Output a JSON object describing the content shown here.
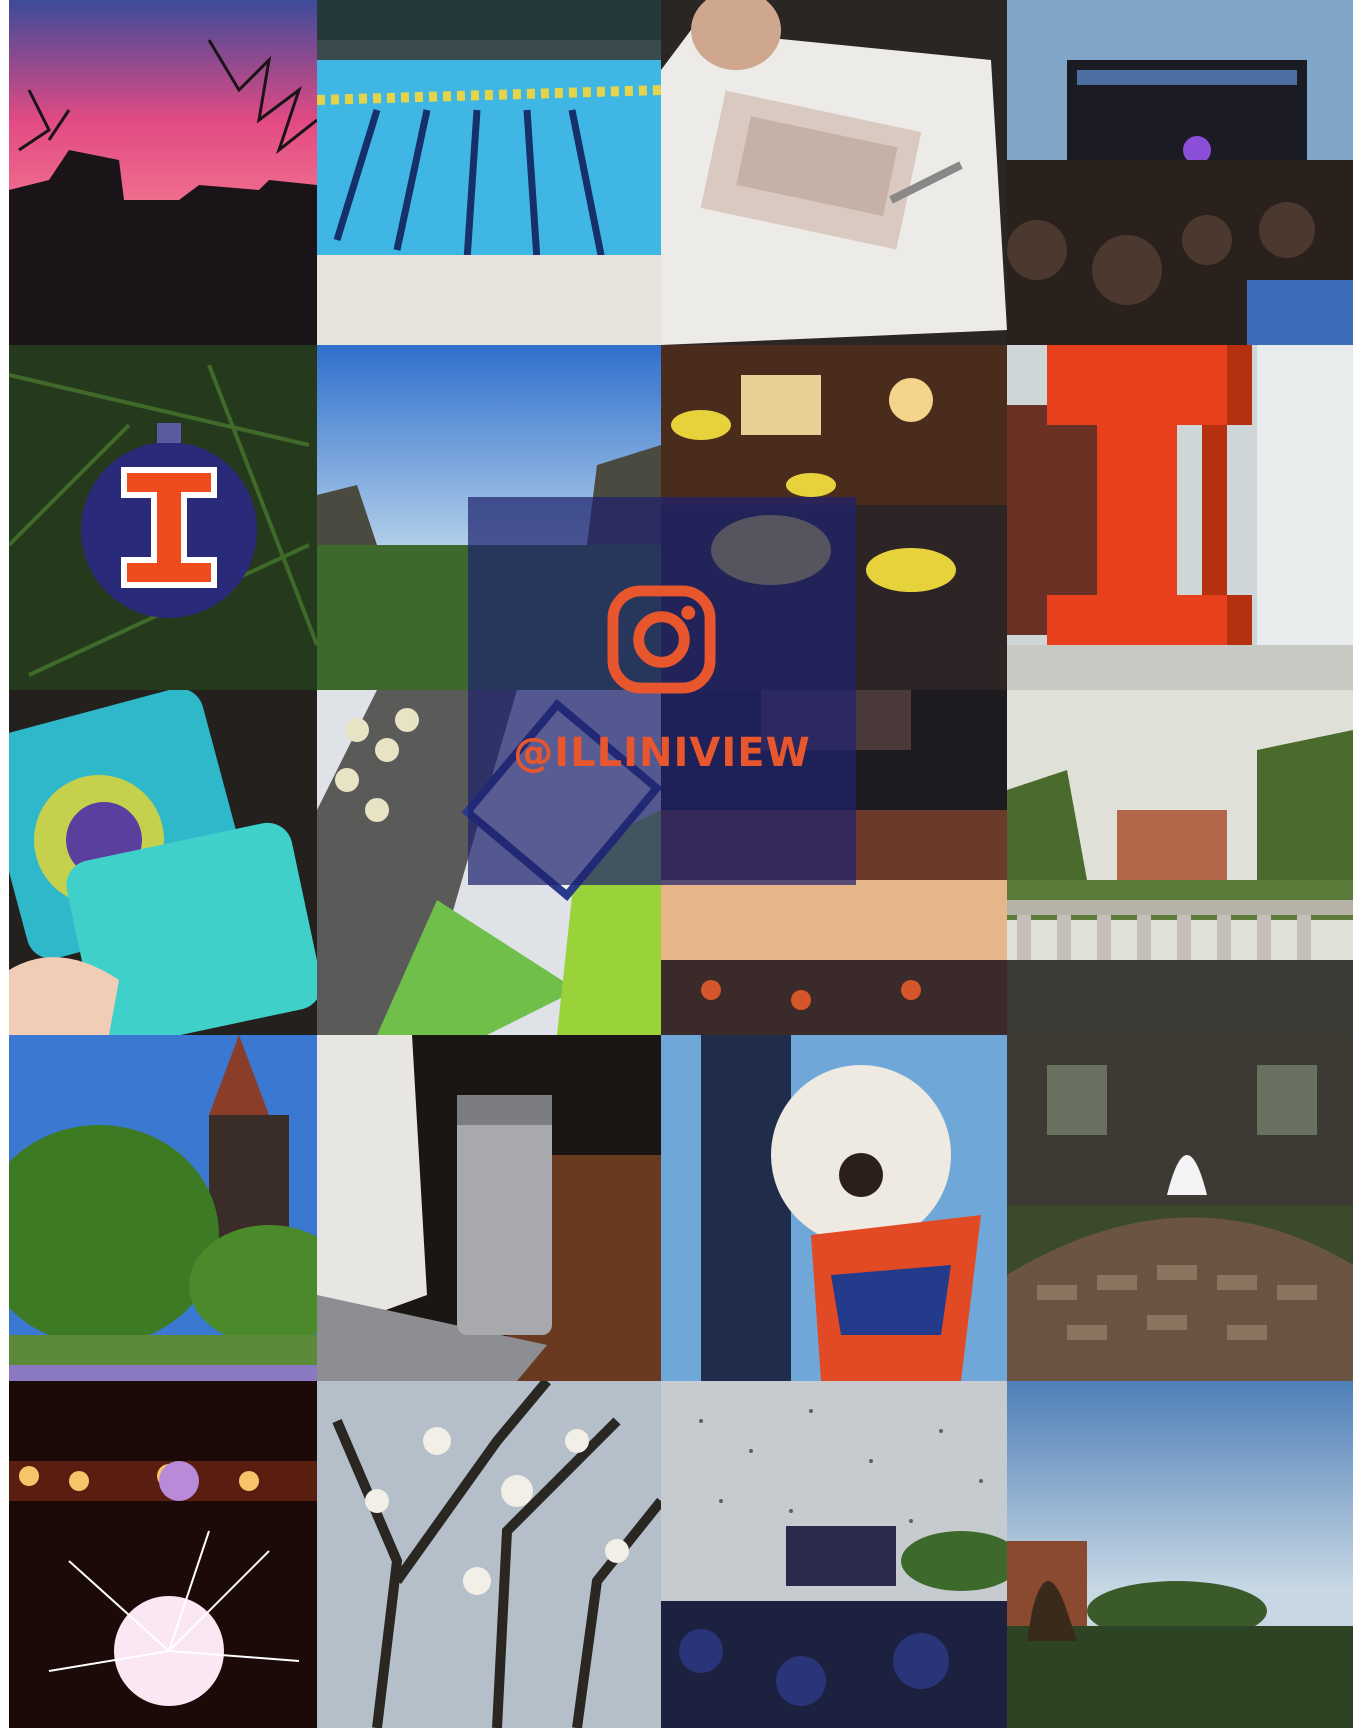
{
  "brand": {
    "accent": "#e8562d",
    "overlay": "#1e236e"
  },
  "social": {
    "icon": "instagram-icon",
    "handle": "@ILLINIVIEW"
  },
  "photos": [
    "sunset-silhouette",
    "swimming-pool",
    "sketchbook-drawing",
    "outdoor-concert",
    "block-i-ornament",
    "main-quad-morning",
    "aquarium-fish",
    "block-i-sculpture",
    "mcb-cookies",
    "mosaic-mural",
    "basketball-arena",
    "quad-balustrade",
    "altgeld-tower",
    "laptop-tumbler",
    "dog-in-bandana",
    "fountain",
    "sparkler-night",
    "blossoming-tree",
    "graduation-confetti",
    "alma-mater-dusk"
  ]
}
